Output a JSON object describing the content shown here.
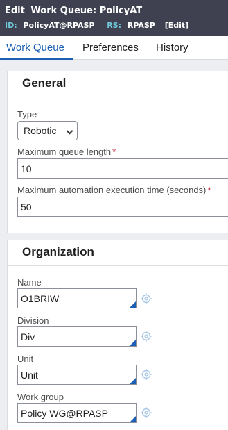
{
  "header": {
    "title_lead": "Edit",
    "title": "Work Queue: PolicyAT",
    "id_label": "ID:",
    "id_value": "PolicyAT@RPASP",
    "rs_label": "RS:",
    "rs_value": "RPASP",
    "edit_link": "[Edit]"
  },
  "tabs": [
    {
      "label": "Work Queue",
      "active": true
    },
    {
      "label": "Preferences",
      "active": false
    },
    {
      "label": "History",
      "active": false
    }
  ],
  "general": {
    "title": "General",
    "type_label": "Type",
    "type_value": "Robotic",
    "max_length_label": "Maximum queue length",
    "max_length_value": "10",
    "max_exec_label": "Maximum automation execution time (seconds)",
    "max_exec_value": "50",
    "required_marker": "*"
  },
  "organization": {
    "title": "Organization",
    "fields": [
      {
        "label": "Name",
        "value": "O1BRIW"
      },
      {
        "label": "Division",
        "value": "Div"
      },
      {
        "label": "Unit",
        "value": "Unit"
      },
      {
        "label": "Work group",
        "value": "Policy WG@RPASP"
      }
    ]
  },
  "colors": {
    "header_bg": "#3f4150",
    "meta_label": "#6fc7d8",
    "accent": "#1a5fb4",
    "required": "#c0001a",
    "icon": "#a7c7e7"
  }
}
